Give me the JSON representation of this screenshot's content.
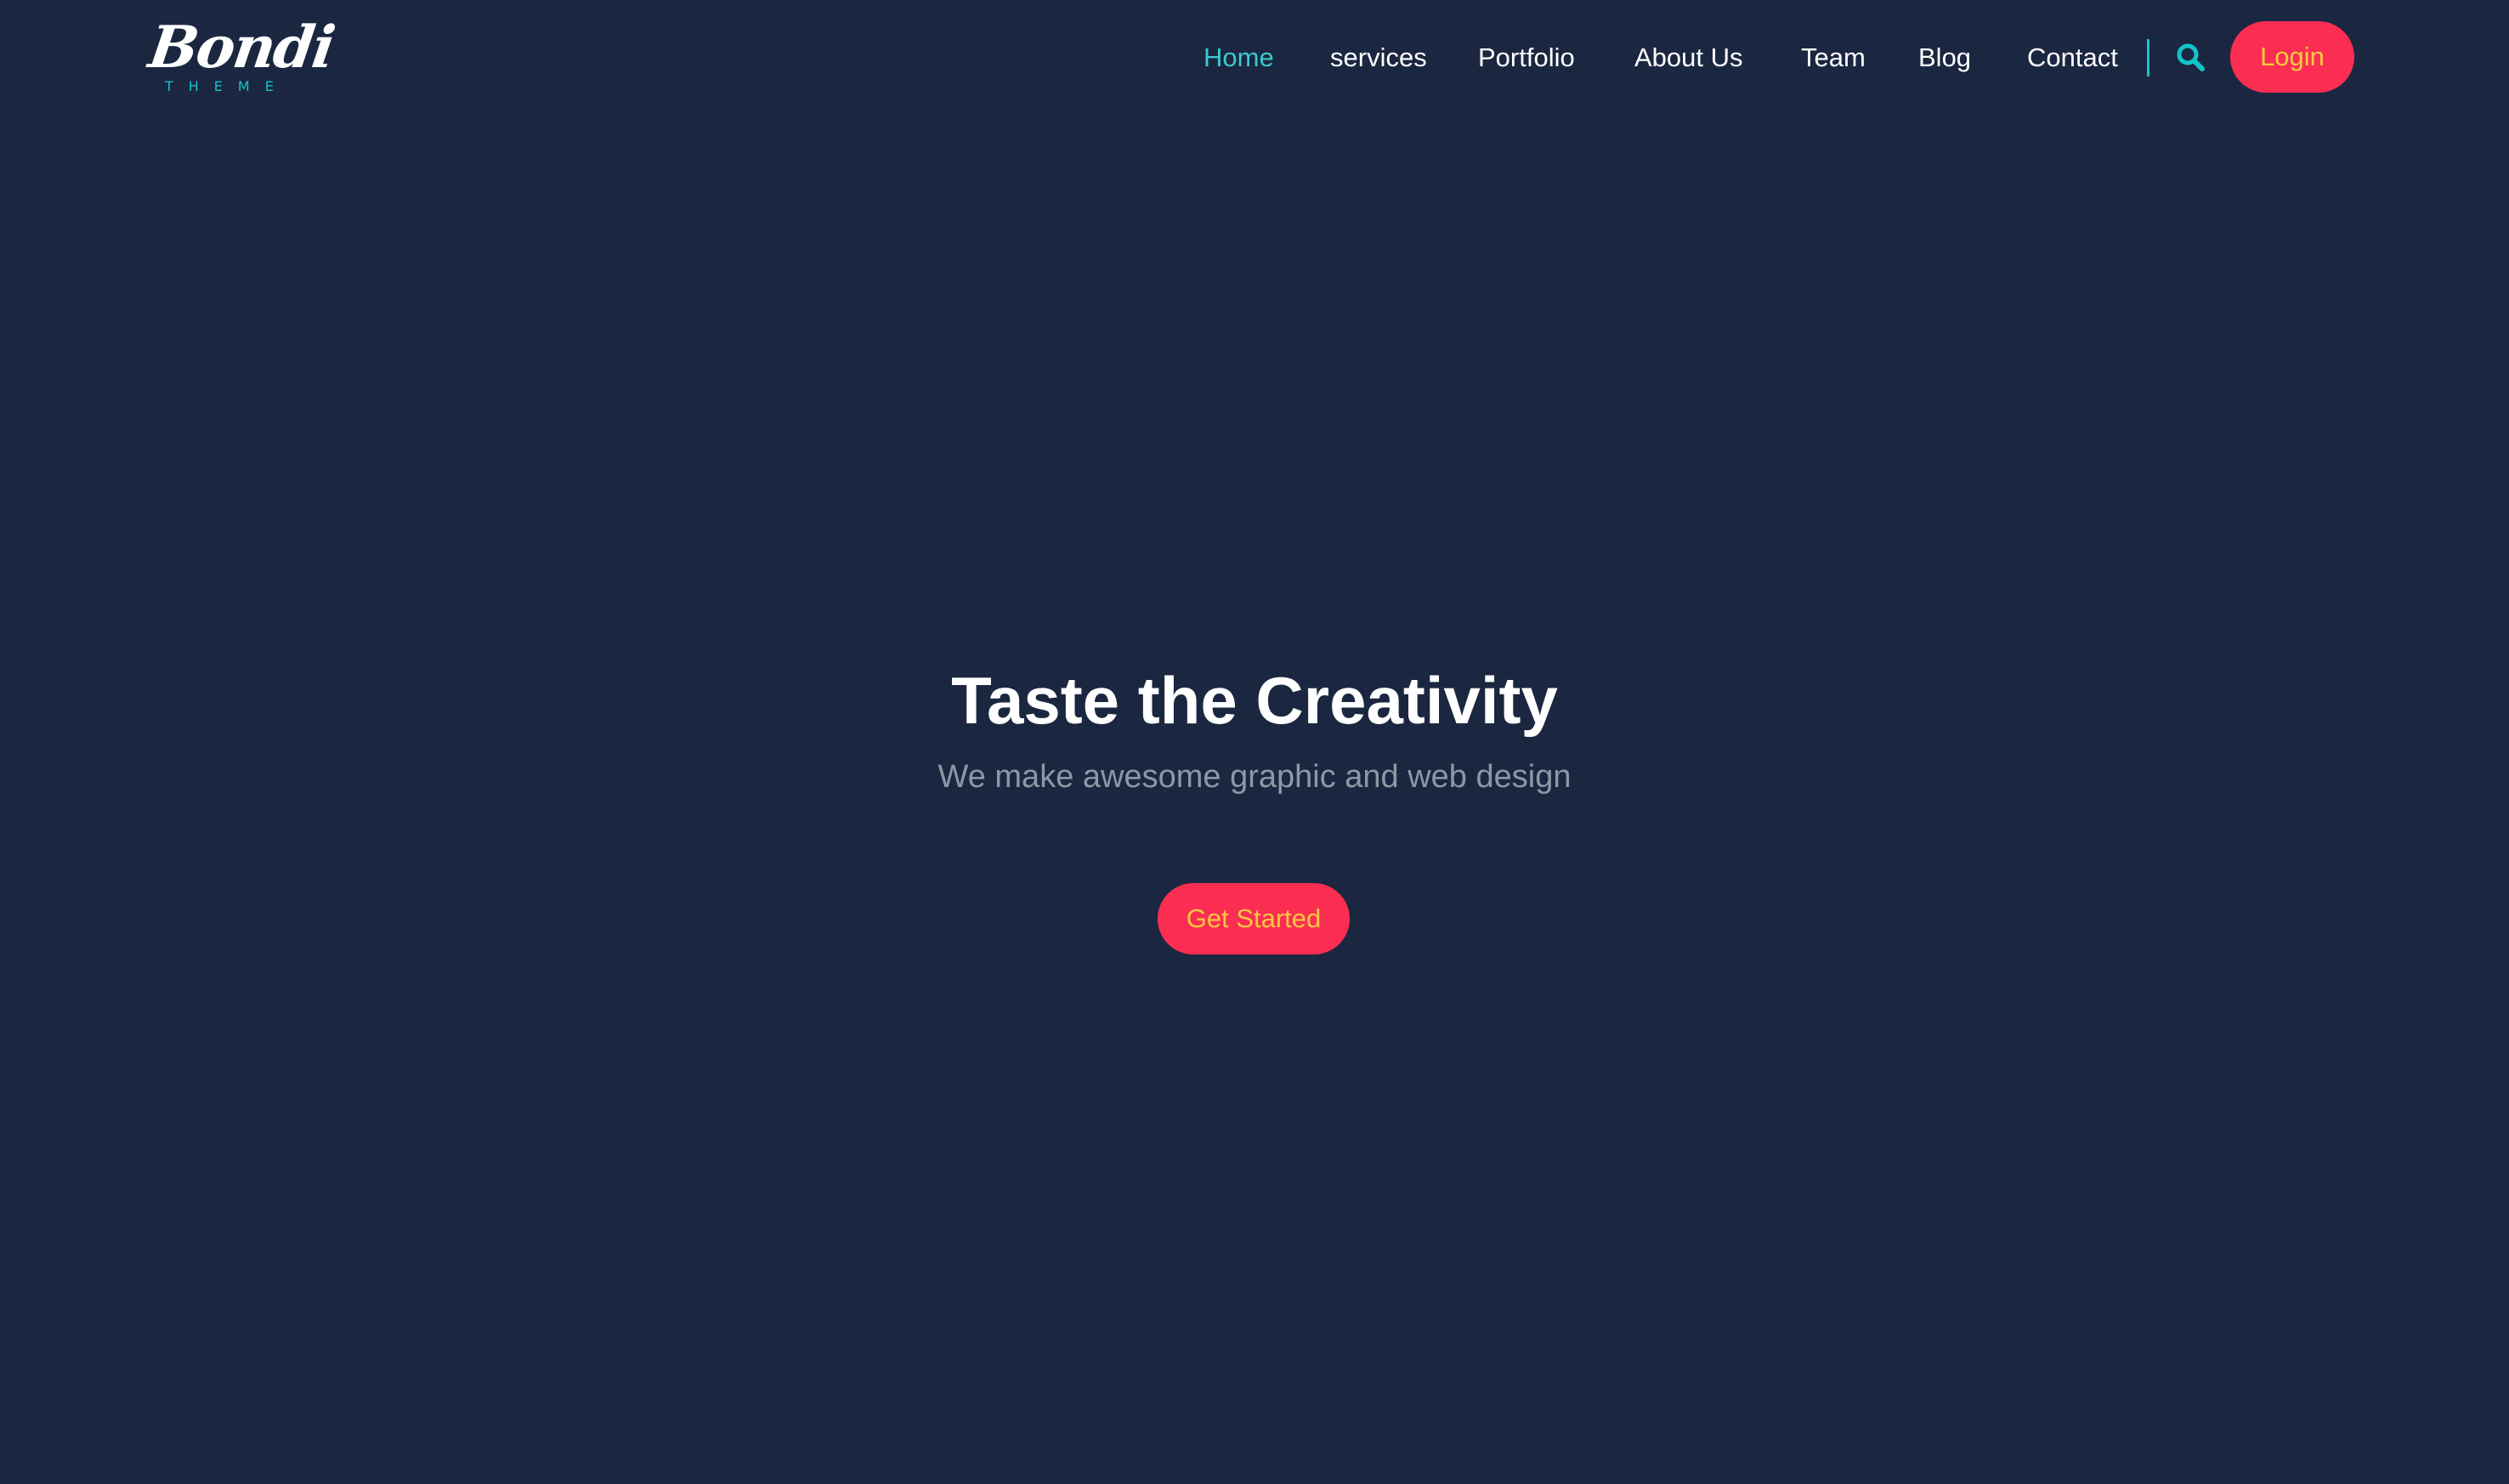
{
  "brand": {
    "logo_word": "Bondi",
    "logo_sub": "THEME"
  },
  "nav": {
    "items": [
      {
        "label": "Home",
        "active": true
      },
      {
        "label": "services",
        "active": false
      },
      {
        "label": "Portfolio",
        "active": false
      },
      {
        "label": "About Us",
        "active": false
      },
      {
        "label": "Team",
        "active": false
      },
      {
        "label": "Blog",
        "active": false
      },
      {
        "label": "Contact",
        "active": false
      }
    ],
    "search_icon": "search-icon",
    "login_label": "Login"
  },
  "hero": {
    "title": "Taste the Creativity",
    "subtitle": "We make awesome graphic and web design",
    "cta_label": "Get Started"
  },
  "colors": {
    "background": "#1b2740",
    "accent_teal": "#13c3cc",
    "active_link": "#3dc8cf",
    "button_bg": "#fc2d53",
    "button_text": "#f6c93f",
    "subtitle_text": "#8f97a6"
  }
}
